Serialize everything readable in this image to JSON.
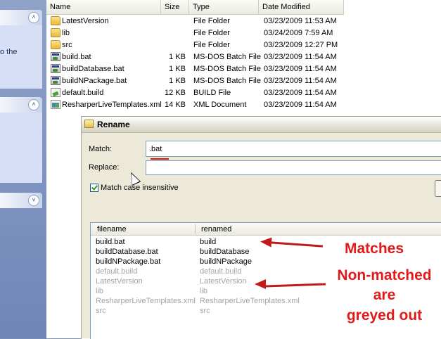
{
  "sidebar": {
    "partial_text": "o the"
  },
  "file_list": {
    "columns": [
      "Name",
      "Size",
      "Type",
      "Date Modified"
    ],
    "rows": [
      {
        "name": "LatestVersion",
        "size": "",
        "type": "File Folder",
        "date": "03/23/2009 11:53 AM",
        "icon": "folder-icon"
      },
      {
        "name": "lib",
        "size": "",
        "type": "File Folder",
        "date": "03/24/2009 7:59 AM",
        "icon": "folder-icon"
      },
      {
        "name": "src",
        "size": "",
        "type": "File Folder",
        "date": "03/23/2009 12:27 PM",
        "icon": "folder-icon"
      },
      {
        "name": "build.bat",
        "size": "1 KB",
        "type": "MS-DOS Batch File",
        "date": "03/23/2009 11:54 AM",
        "icon": "batch-file-icon"
      },
      {
        "name": "buildDatabase.bat",
        "size": "1 KB",
        "type": "MS-DOS Batch File",
        "date": "03/23/2009 11:54 AM",
        "icon": "batch-file-icon"
      },
      {
        "name": "buildNPackage.bat",
        "size": "1 KB",
        "type": "MS-DOS Batch File",
        "date": "03/23/2009 11:54 AM",
        "icon": "batch-file-icon"
      },
      {
        "name": "default.build",
        "size": "12 KB",
        "type": "BUILD File",
        "date": "03/23/2009 11:54 AM",
        "icon": "build-file-icon"
      },
      {
        "name": "ResharperLiveTemplates.xml",
        "size": "14 KB",
        "type": "XML Document",
        "date": "03/23/2009 11:54 AM",
        "icon": "xml-file-icon"
      }
    ]
  },
  "dialog": {
    "title": "Rename",
    "match_label": "Match:",
    "match_value": ".bat",
    "replace_label": "Replace:",
    "replace_value": "",
    "checkbox_label": "Match case insensitive",
    "checkbox_checked": true,
    "list_headers": [
      "filename",
      "renamed"
    ],
    "list_rows": [
      {
        "filename": "build.bat",
        "renamed": "build",
        "matched": true
      },
      {
        "filename": "buildDatabase.bat",
        "renamed": "buildDatabase",
        "matched": true
      },
      {
        "filename": "buildNPackage.bat",
        "renamed": "buildNPackage",
        "matched": true
      },
      {
        "filename": "default.build",
        "renamed": "default.build",
        "matched": false
      },
      {
        "filename": "LatestVersion",
        "renamed": "LatestVersion",
        "matched": false
      },
      {
        "filename": "lib",
        "renamed": "lib",
        "matched": false
      },
      {
        "filename": "ResharperLiveTemplates.xml",
        "renamed": "ResharperLiveTemplates.xml",
        "matched": false
      },
      {
        "filename": "src",
        "renamed": "src",
        "matched": false
      }
    ]
  },
  "annotations": {
    "matches": "Matches",
    "non_matched_line1": "Non-matched",
    "non_matched_line2": "are",
    "non_matched_line3": "greyed out"
  },
  "colors": {
    "annotation": "#e11a1a",
    "greyed_text": "#a3a3a3"
  }
}
